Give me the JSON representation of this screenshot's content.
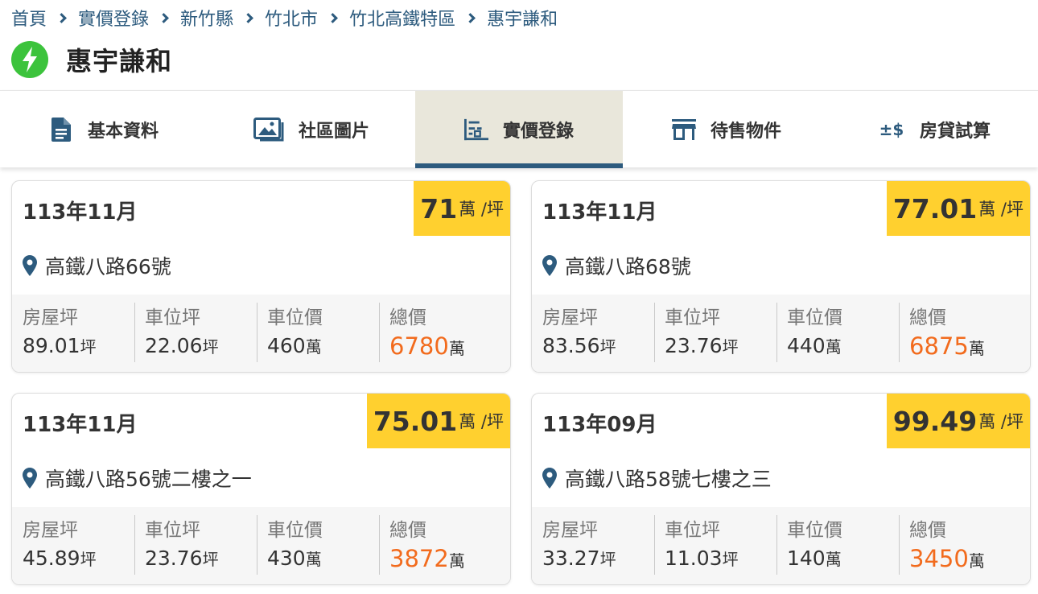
{
  "breadcrumb": [
    "首頁",
    "實價登錄",
    "新竹縣",
    "竹北市",
    "竹北高鐵特區",
    "惠宇謙和"
  ],
  "page_title": "惠宇謙和",
  "tabs": [
    {
      "label": "基本資料",
      "icon": "document-icon",
      "active": false
    },
    {
      "label": "社區圖片",
      "icon": "images-icon",
      "active": false
    },
    {
      "label": "實價登錄",
      "icon": "price-list-icon",
      "active": true
    },
    {
      "label": "待售物件",
      "icon": "store-icon",
      "active": false
    },
    {
      "label": "房貸試算",
      "icon": "plus-minus-dollar-icon",
      "active": false
    }
  ],
  "labels": {
    "unit_price_suffix": "萬 /坪",
    "house_area": "房屋坪",
    "parking_area": "車位坪",
    "parking_price": "車位價",
    "total_price": "總價",
    "ping": "坪",
    "wan": "萬"
  },
  "records": [
    {
      "date": "113年11月",
      "unit_price": "71",
      "address": "高鐵八路66號",
      "house_area": "89.01",
      "parking_area": "22.06",
      "parking_price": "460",
      "total": "6780"
    },
    {
      "date": "113年11月",
      "unit_price": "77.01",
      "address": "高鐵八路68號",
      "house_area": "83.56",
      "parking_area": "23.76",
      "parking_price": "440",
      "total": "6875"
    },
    {
      "date": "113年11月",
      "unit_price": "75.01",
      "address": "高鐵八路56號二樓之一",
      "house_area": "45.89",
      "parking_area": "23.76",
      "parking_price": "430",
      "total": "3872"
    },
    {
      "date": "113年09月",
      "unit_price": "99.49",
      "address": "高鐵八路58號七樓之三",
      "house_area": "33.27",
      "parking_area": "11.03",
      "parking_price": "140",
      "total": "3450"
    }
  ],
  "colors": {
    "accent": "#2d5b7e",
    "price_badge": "#ffd02f",
    "total": "#f26b1d",
    "bolt": "#3cc33c",
    "active_tab_bg": "#e9e7db"
  }
}
